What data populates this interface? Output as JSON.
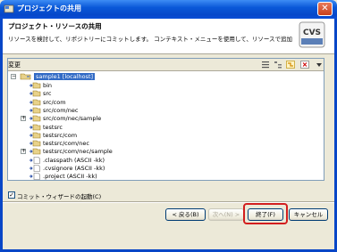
{
  "window": {
    "title": "プロジェクトの共用",
    "close": "✕"
  },
  "header": {
    "title": "プロジェクト・リソースの共用",
    "description": "リソースを検討して、リポジトリーにコミットします。 コンテキスト・メニューを使用して、リソースで追加操作を実行してください",
    "logo_text": "CVS"
  },
  "changes": {
    "label": "変更"
  },
  "tree": {
    "root": "sample1   [localhost]",
    "items": [
      {
        "label": "bin",
        "expandable": false
      },
      {
        "label": "src",
        "expandable": false
      },
      {
        "label": "src/com",
        "expandable": false
      },
      {
        "label": "src/com/nec",
        "expandable": false
      },
      {
        "label": "src/com/nec/sample",
        "expandable": true
      },
      {
        "label": "testsrc",
        "expandable": false
      },
      {
        "label": "testsrc/com",
        "expandable": false
      },
      {
        "label": "testsrc/com/nec",
        "expandable": false
      },
      {
        "label": "testsrc/com/nec/sample",
        "expandable": true
      },
      {
        "label": ".classpath    (ASCII -kk)",
        "expandable": false
      },
      {
        "label": ".cvsignore    (ASCII -kk)",
        "expandable": false
      },
      {
        "label": ".project     (ASCII -kk)",
        "expandable": false
      }
    ]
  },
  "options": {
    "commit_wizard_label": "コミット・ウィザードの起動(C)",
    "commit_wizard_checked": true,
    "check_mark": "✓"
  },
  "buttons": {
    "back": "< 戻る(B)",
    "next": "次へ(N) >",
    "finish": "終了(F)",
    "cancel": "キャンセル"
  },
  "colors": {
    "titlebar": "#0a58d8",
    "highlight": "#d21e1e",
    "selection": "#316ac5"
  }
}
